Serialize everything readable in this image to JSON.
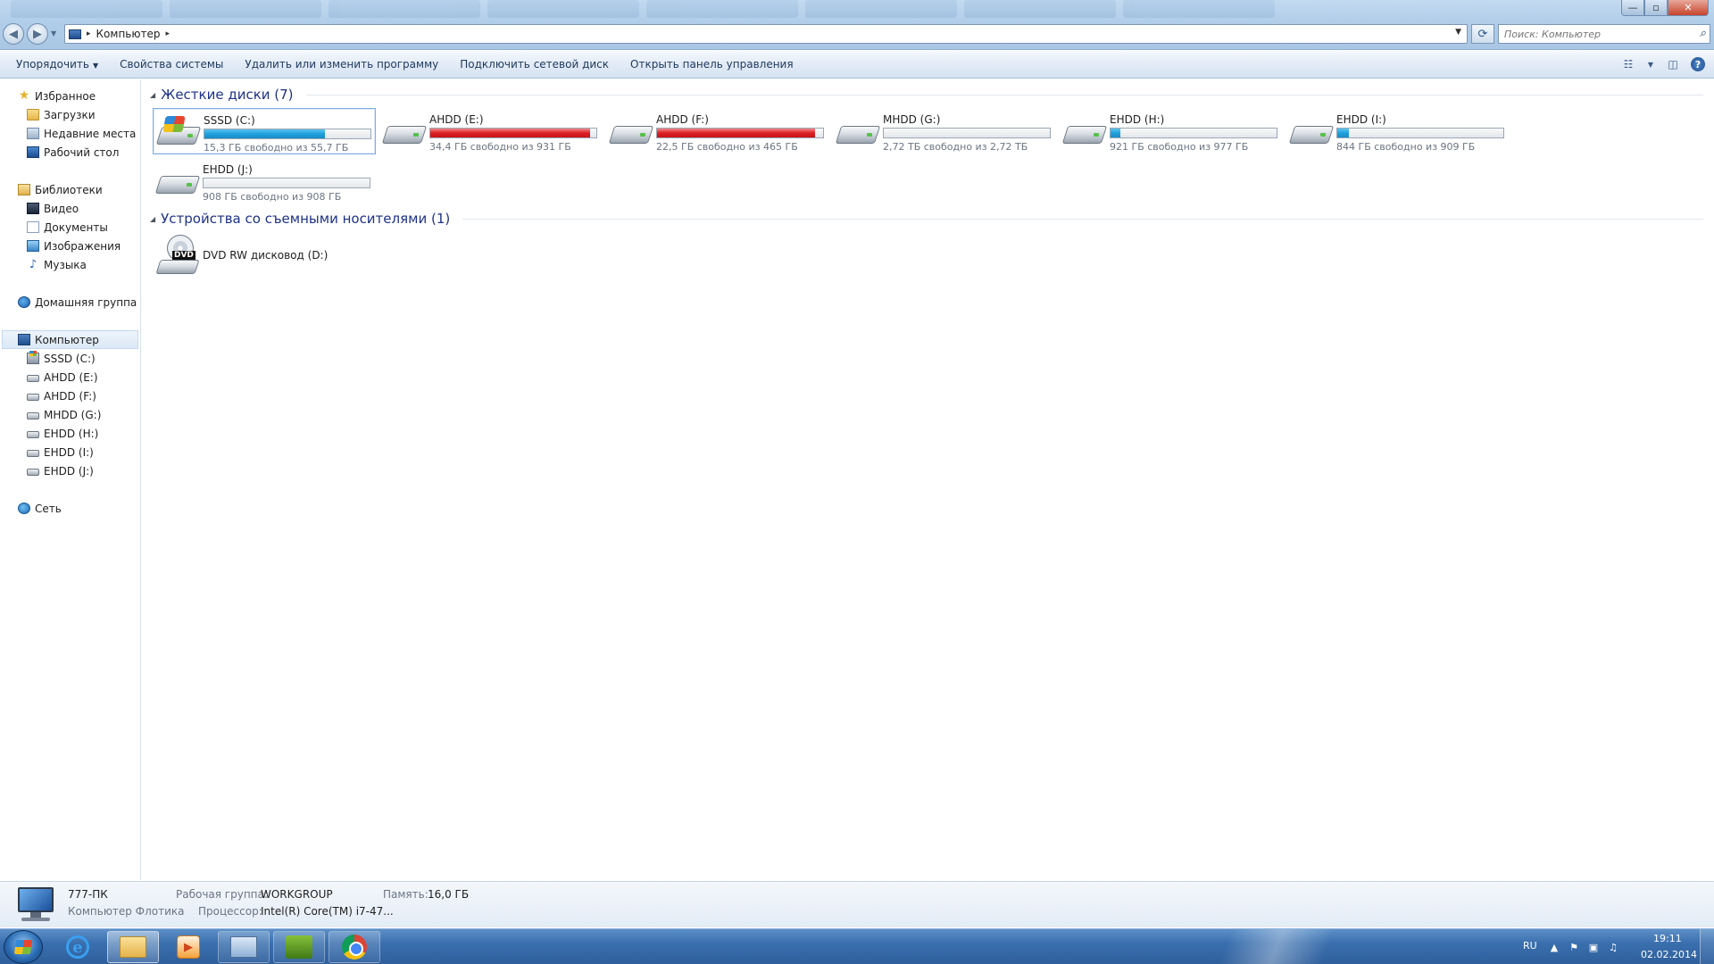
{
  "window": {
    "min_glyph": "—",
    "max_glyph": "▫",
    "close_glyph": "✕"
  },
  "address": {
    "location": "Компьютер",
    "separator": "▸"
  },
  "search": {
    "placeholder": "Поиск: Компьютер"
  },
  "toolbar": {
    "organize": "Упорядочить",
    "system_properties": "Свойства системы",
    "uninstall_program": "Удалить или изменить программу",
    "map_network_drive": "Подключить сетевой диск",
    "open_control_panel": "Открыть панель управления"
  },
  "sidebar": {
    "favorites": {
      "label": "Избранное",
      "items": [
        "Загрузки",
        "Недавние места",
        "Рабочий стол"
      ]
    },
    "libraries": {
      "label": "Библиотеки",
      "items": [
        "Видео",
        "Документы",
        "Изображения",
        "Музыка"
      ]
    },
    "homegroup": "Домашняя группа",
    "computer": {
      "label": "Компьютер",
      "items": [
        "SSSD (C:)",
        "AHDD (E:)",
        "AHDD (F:)",
        "MHDD (G:)",
        "EHDD (H:)",
        "EHDD (I:)",
        "EHDD (J:)"
      ]
    },
    "network": "Сеть"
  },
  "content": {
    "hard_disks_header": "Жесткие диски (7)",
    "removable_header": "Устройства со съемными носителями (1)",
    "drives": [
      {
        "name": "SSSD (C:)",
        "free": "15,3 ГБ свободно из 55,7 ГБ",
        "used_fraction": 0.725,
        "bar_color": "blue",
        "system": true,
        "selected": true
      },
      {
        "name": "AHDD (E:)",
        "free": "34,4 ГБ свободно из 931 ГБ",
        "used_fraction": 0.963,
        "bar_color": "red"
      },
      {
        "name": "AHDD (F:)",
        "free": "22,5 ГБ свободно из 465 ГБ",
        "used_fraction": 0.952,
        "bar_color": "red"
      },
      {
        "name": "MHDD (G:)",
        "free": "2,72 ТБ свободно из 2,72 ТБ",
        "used_fraction": 0.0,
        "bar_color": "blue"
      },
      {
        "name": "EHDD (H:)",
        "free": "921 ГБ свободно из 977 ГБ",
        "used_fraction": 0.057,
        "bar_color": "blue"
      },
      {
        "name": "EHDD (I:)",
        "free": "844 ГБ свободно из 909 ГБ",
        "used_fraction": 0.072,
        "bar_color": "blue"
      },
      {
        "name": "EHDD (J:)",
        "free": "908 ГБ свободно из 908 ГБ",
        "used_fraction": 0.0,
        "bar_color": "blue"
      }
    ],
    "dvd": {
      "name": "DVD RW дисковод (D:)",
      "badge": "DVD"
    }
  },
  "details": {
    "computer_name": "777-ПК",
    "description": "Компьютер Флотика",
    "workgroup_label": "Рабочая группа:",
    "workgroup_value": "WORKGROUP",
    "memory_label": "Память:",
    "memory_value": "16,0 ГБ",
    "processor_label": "Процессор:",
    "processor_value": "Intel(R) Core(TM) i7-47..."
  },
  "taskbar": {
    "language": "RU",
    "time": "19:11",
    "date": "02.02.2014"
  },
  "colors": {
    "bar_blue": "#1fa1dd",
    "bar_red": "#dc2025",
    "group_header": "#1e3287",
    "taskbar": "#3a6fae"
  }
}
